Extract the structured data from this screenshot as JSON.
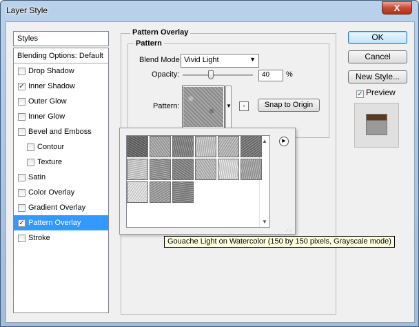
{
  "window": {
    "title": "Layer Style",
    "close_label": "X"
  },
  "styles_panel": {
    "header": "Styles",
    "items": [
      {
        "label": "Blending Options: Default",
        "checkbox": false,
        "checked": false,
        "sub": false,
        "selected": false
      },
      {
        "label": "Drop Shadow",
        "checkbox": true,
        "checked": false,
        "sub": false,
        "selected": false
      },
      {
        "label": "Inner Shadow",
        "checkbox": true,
        "checked": true,
        "sub": false,
        "selected": false
      },
      {
        "label": "Outer Glow",
        "checkbox": true,
        "checked": false,
        "sub": false,
        "selected": false
      },
      {
        "label": "Inner Glow",
        "checkbox": true,
        "checked": false,
        "sub": false,
        "selected": false
      },
      {
        "label": "Bevel and Emboss",
        "checkbox": true,
        "checked": false,
        "sub": false,
        "selected": false
      },
      {
        "label": "Contour",
        "checkbox": true,
        "checked": false,
        "sub": true,
        "selected": false
      },
      {
        "label": "Texture",
        "checkbox": true,
        "checked": false,
        "sub": true,
        "selected": false
      },
      {
        "label": "Satin",
        "checkbox": true,
        "checked": false,
        "sub": false,
        "selected": false
      },
      {
        "label": "Color Overlay",
        "checkbox": true,
        "checked": false,
        "sub": false,
        "selected": false
      },
      {
        "label": "Gradient Overlay",
        "checkbox": true,
        "checked": false,
        "sub": false,
        "selected": false
      },
      {
        "label": "Pattern Overlay",
        "checkbox": true,
        "checked": true,
        "sub": false,
        "selected": true
      },
      {
        "label": "Stroke",
        "checkbox": true,
        "checked": false,
        "sub": false,
        "selected": false
      }
    ]
  },
  "pattern_overlay": {
    "section_title": "Pattern Overlay",
    "group_title": "Pattern",
    "blend_mode_label": "Blend Mode:",
    "blend_mode_value": "Vivid Light",
    "opacity_label": "Opacity:",
    "opacity_value": "40",
    "opacity_fraction": 0.4,
    "opacity_unit": "%",
    "pattern_label": "Pattern:",
    "snap_button": "Snap to Origin"
  },
  "buttons": {
    "ok": "OK",
    "cancel": "Cancel",
    "new_style": "New Style...",
    "preview": "Preview",
    "preview_checked": true
  },
  "pattern_picker": {
    "swatch_count": 15,
    "swatch_tones": [
      "#6a6a6a",
      "#b4b4b4",
      "#8a8a8a",
      "#d4d4d4",
      "#c6c6c6",
      "#7c7c7c",
      "#dcdcdc",
      "#9e9e9e",
      "#8c8c8c",
      "#c8c8c8",
      "#ececec",
      "#b0b0b0",
      "#f4f4f4",
      "#a8a8a8",
      "#8e8e8e",
      "#7e7e7e",
      "#9a9a9a",
      "#bcbcbc",
      "#c2c2c2",
      "#9c9c9c",
      "#787878"
    ],
    "tooltip": "Gouache Light on Watercolor (150 by 150 pixels, Grayscale mode)"
  },
  "colors": {
    "selection": "#3399ff",
    "dialog_bg": "#f0f0f0",
    "tooltip_bg": "#ffffe1"
  },
  "icons": {
    "close": "close-icon",
    "dropdown": "chevron-down-icon",
    "flyout": "flyout-menu-icon",
    "new_preset": "new-preset-icon",
    "check": "checkmark-icon"
  }
}
